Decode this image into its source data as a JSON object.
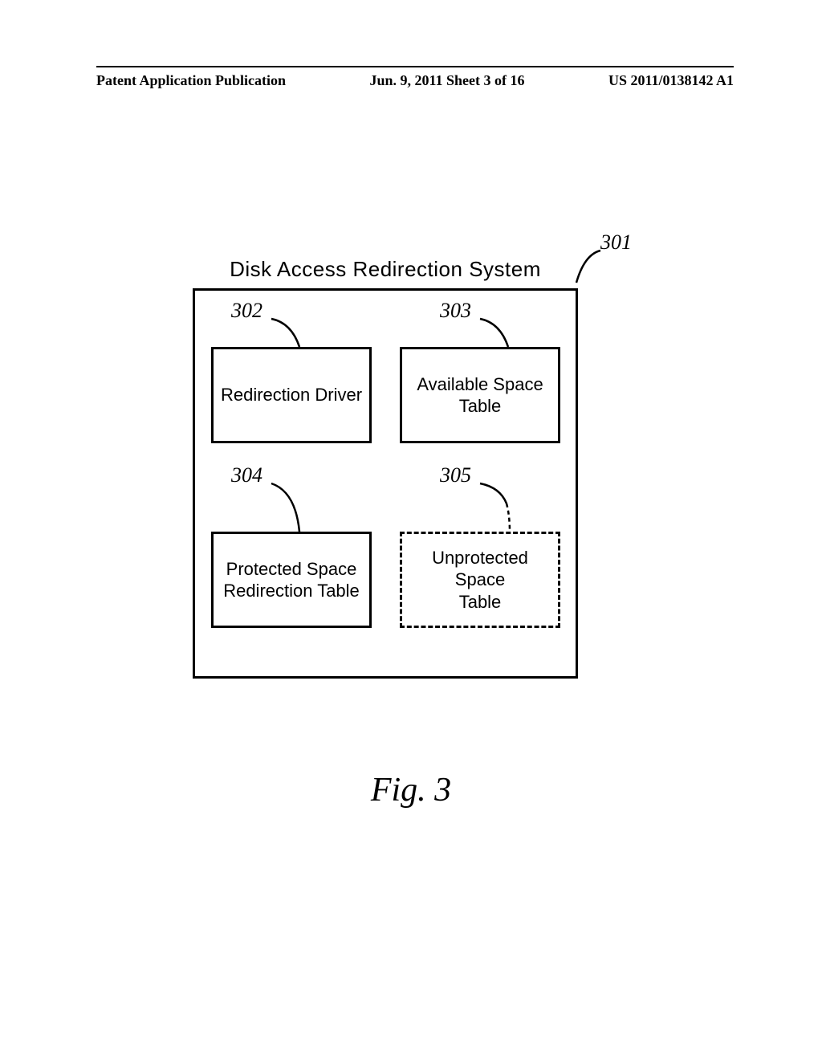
{
  "header": {
    "left": "Patent Application Publication",
    "center": "Jun. 9, 2011  Sheet 3 of 16",
    "right": "US 2011/0138142 A1"
  },
  "diagram": {
    "title": "Disk Access Redirection System",
    "box302": "Redirection Driver",
    "box303": "Available Space\nTable",
    "box304": "Protected Space\nRedirection Table",
    "box305": "Unprotected Space\nTable",
    "ref301": "301",
    "ref302": "302",
    "ref303": "303",
    "ref304": "304",
    "ref305": "305"
  },
  "figure_label": "Fig. 3"
}
